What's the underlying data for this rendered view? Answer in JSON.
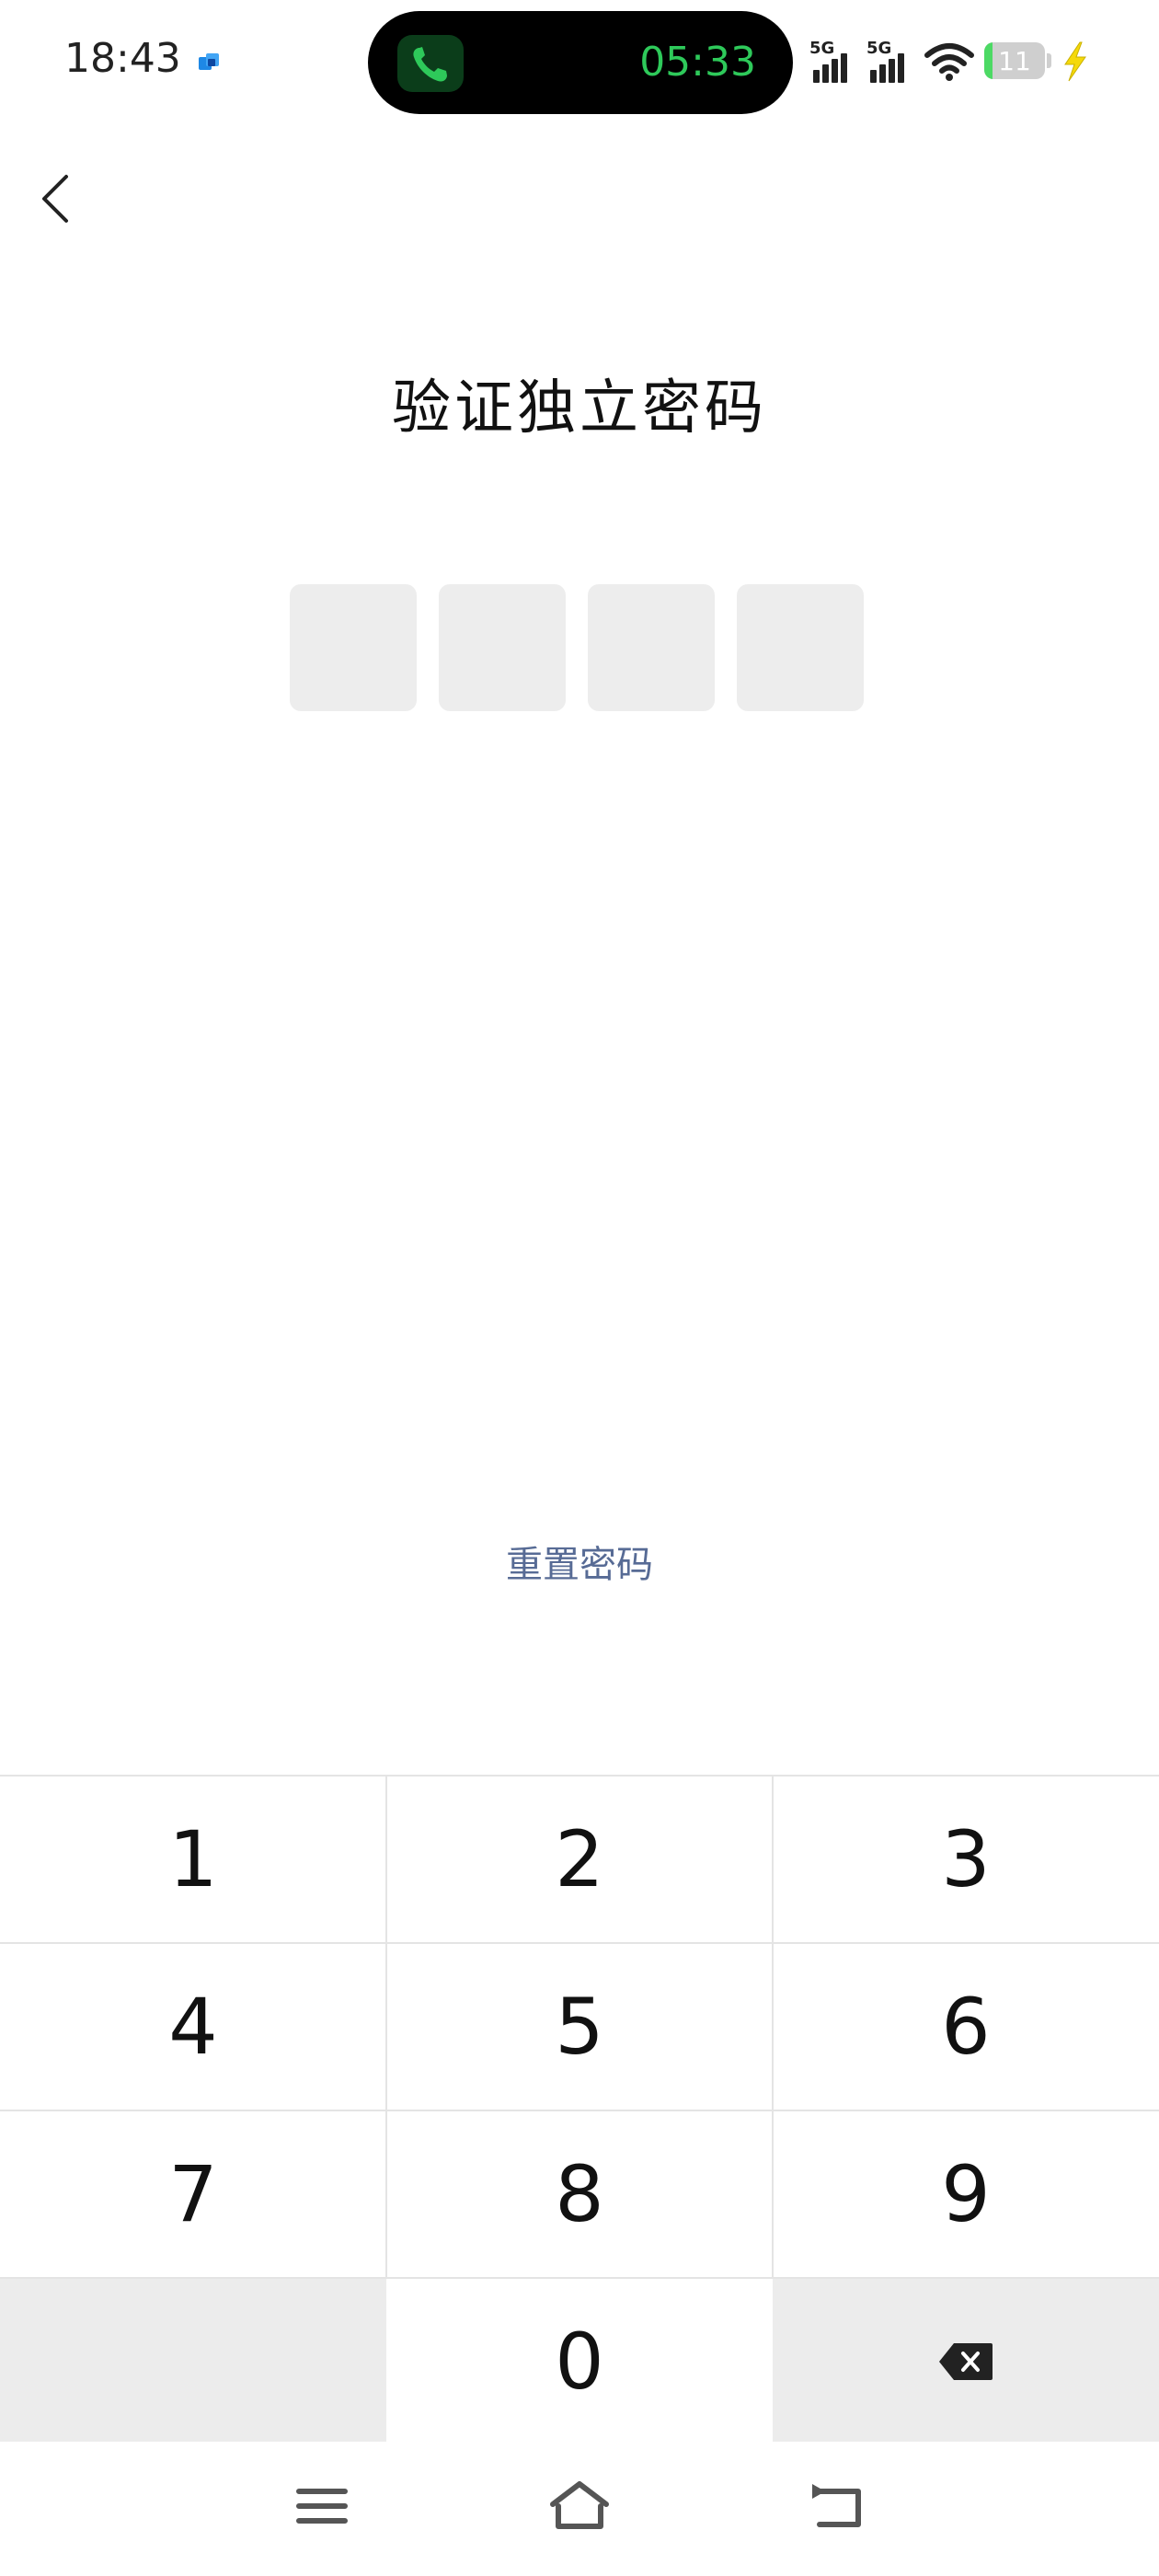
{
  "status_bar": {
    "time": "18:43",
    "call_timer": "05:33",
    "signal_1_label": "5G",
    "signal_2_label": "5G",
    "battery_level": "11",
    "colors": {
      "call_timer": "#2ec95a",
      "battery_fill": "#4cd964",
      "charging_bolt": "#f5d90a"
    }
  },
  "header": {
    "back_icon": "chevron-left-icon",
    "title": "验证独立密码"
  },
  "pin": {
    "length": 4,
    "entered": 0
  },
  "reset_link": {
    "label": "重置密码",
    "color": "#576b95"
  },
  "keypad": {
    "keys": [
      "1",
      "2",
      "3",
      "4",
      "5",
      "6",
      "7",
      "8",
      "9",
      "",
      "0",
      "backspace"
    ],
    "backspace_icon": "backspace-icon"
  },
  "navbar": {
    "icons": [
      "menu-icon",
      "home-icon",
      "back-icon"
    ]
  }
}
